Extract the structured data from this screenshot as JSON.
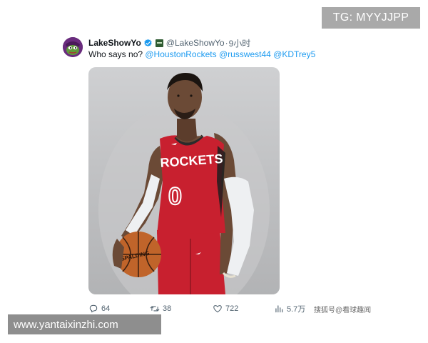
{
  "watermarks": {
    "top_right": "TG: MYYJJPP",
    "side": "搜狐号@看球趣闻",
    "bottom_left": "www.yantaixinzhi.com"
  },
  "tweet": {
    "display_name": "LakeShowYo",
    "handle": "@LakeShowYo",
    "separator": "·",
    "time": "9小时",
    "verified_icon": "verified-badge-icon",
    "affiliate_icon": "affiliate-badge-icon",
    "text": "Who says no? ",
    "mentions": [
      "@HoustonRockets",
      "@russwest44",
      "@KDTrey5"
    ],
    "image": {
      "jersey_text": "ROCKETS",
      "jersey_number": "0",
      "ball_text": "SPALDING"
    }
  },
  "actions": {
    "reply": {
      "icon": "reply-icon",
      "count": "64"
    },
    "retweet": {
      "icon": "retweet-icon",
      "count": "38"
    },
    "like": {
      "icon": "heart-icon",
      "count": "722"
    },
    "views": {
      "icon": "views-icon",
      "count": "5.7万"
    }
  },
  "colors": {
    "mention": "#1d9bf0",
    "secondary_text": "#536471",
    "verified": "#1d9bf0",
    "jersey": "#c8202f"
  }
}
